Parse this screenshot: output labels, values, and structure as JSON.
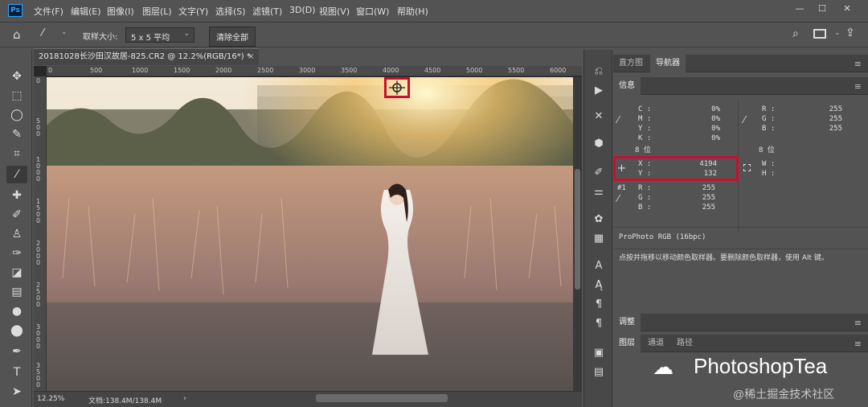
{
  "app": {
    "logo": "Ps"
  },
  "menus": [
    "文件(F)",
    "编辑(E)",
    "图像(I)",
    "图层(L)",
    "文字(Y)",
    "选择(S)",
    "滤镜(T)",
    "3D(D)",
    "视图(V)",
    "窗口(W)",
    "帮助(H)"
  ],
  "window_buttons": [
    "—",
    "☐",
    "✕"
  ],
  "options": {
    "sample_size_label": "取样大小:",
    "sample_size_value": "5 x 5 平均",
    "clear_all": "清除全部"
  },
  "document": {
    "tab_title": "20181028长沙田汉故居-825.CR2 @ 12.2%(RGB/16*) *",
    "close_icon": "×",
    "zoom": "12.25%",
    "doc_size": "文档:138.4M/138.4M"
  },
  "ruler": {
    "top_ticks": [
      "0",
      "500",
      "1000",
      "1500",
      "2000",
      "2500",
      "3000",
      "3500",
      "4000",
      "4500",
      "5000",
      "5500",
      "6000"
    ],
    "left_ticks": [
      "0",
      "5 0 0",
      "1 0 0 0",
      "1 5 0 0",
      "2 0 0 0",
      "2 5 0 0",
      "3 0 0 0",
      "3 5 0 0"
    ]
  },
  "panels": {
    "top_tabs": [
      "直方图",
      "导航器"
    ],
    "info_tab": "信息",
    "cmyk": {
      "C": "0%",
      "M": "0%",
      "Y": "0%",
      "K": "0%",
      "bits": "8 位"
    },
    "rgb": {
      "R": "255",
      "G": "255",
      "B": "255",
      "bits": "8 位"
    },
    "xy": {
      "X_label": "X :",
      "X": "4194",
      "Y_label": "Y :",
      "Y": "132"
    },
    "wh": {
      "W_label": "W :",
      "H_label": "H :"
    },
    "sampler": {
      "id": "#1",
      "R": "255",
      "G": "255",
      "B": "255"
    },
    "profile": "ProPhoto RGB (16bpc)",
    "hint": "点按并拖移以移动颜色取样器。要删除颜色取样器，使用 Alt 键。",
    "adjust_tab": "调整",
    "layer_tabs": [
      "图层",
      "通道",
      "路径"
    ]
  },
  "watermark": {
    "brand": "PhotoshopTea",
    "source": "@稀土掘金技术社区"
  },
  "colors": {
    "highlight": "#c8102e",
    "panel_bg": "#535353"
  }
}
